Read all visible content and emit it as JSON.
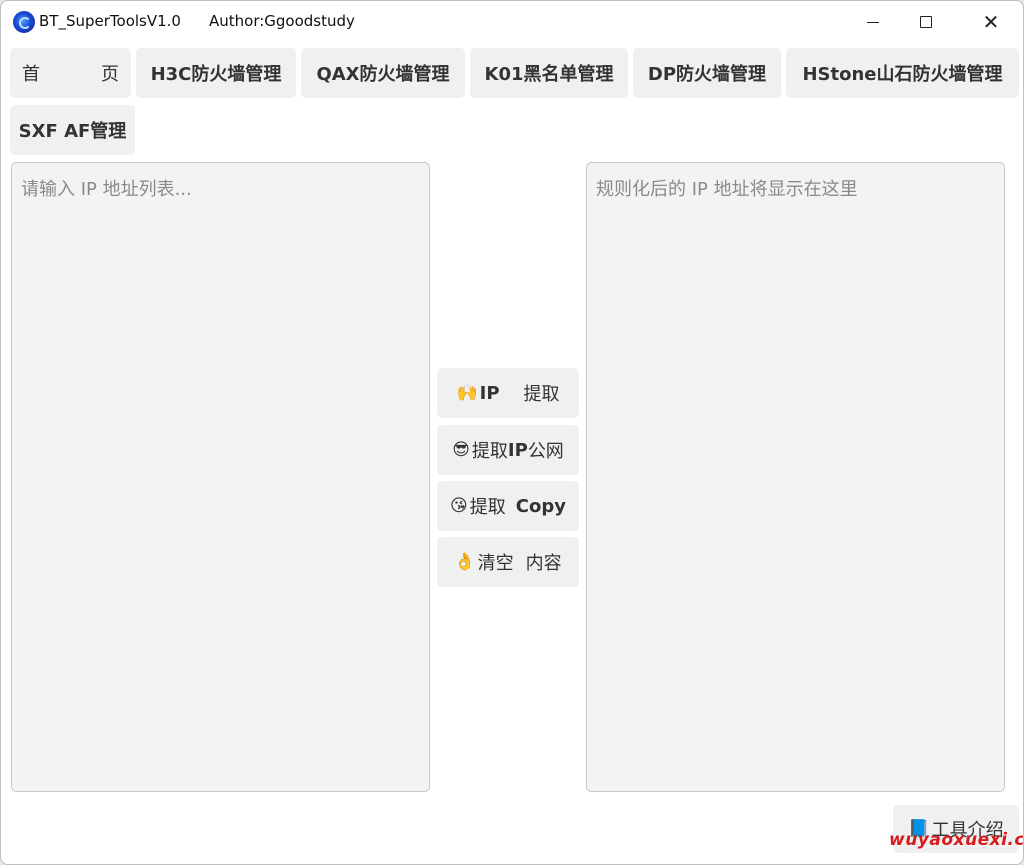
{
  "window": {
    "title": "BT_SuperToolsV1.0",
    "author": "Author:Ggoodstudy",
    "controls": {
      "minimize": "minimize-icon",
      "maximize": "maximize-icon",
      "close": "close-icon",
      "close_glyph": "✕"
    }
  },
  "nav": {
    "home": {
      "left": "首",
      "right": "页"
    },
    "tabs": [
      "H3C防火墙管理",
      "QAX防火墙管理",
      "K01黑名单管理",
      "DP防火墙管理",
      "HStone山石防火墙管理",
      "SXF AF管理"
    ]
  },
  "input": {
    "placeholder": "请输入 IP 地址列表..."
  },
  "output": {
    "placeholder": "规则化后的 IP 地址将显示在这里"
  },
  "actions": [
    {
      "emoji": "🙌",
      "a": "IP",
      "b": "提取"
    },
    {
      "emoji": "😎",
      "a": "提取",
      "b": "IP",
      "c": "公网"
    },
    {
      "emoji": "😘",
      "a": "提取",
      "b": "Copy"
    },
    {
      "emoji": "👌",
      "a": "清空",
      "b": "内容"
    }
  ],
  "about": {
    "emoji": "📘",
    "label": "工具介绍"
  },
  "watermark": "wuyaoxuexi.cn",
  "colors": {
    "button_bg": "#f0f0f0",
    "textarea_bg": "#f3f3f3",
    "watermark": "#d81b1b"
  }
}
